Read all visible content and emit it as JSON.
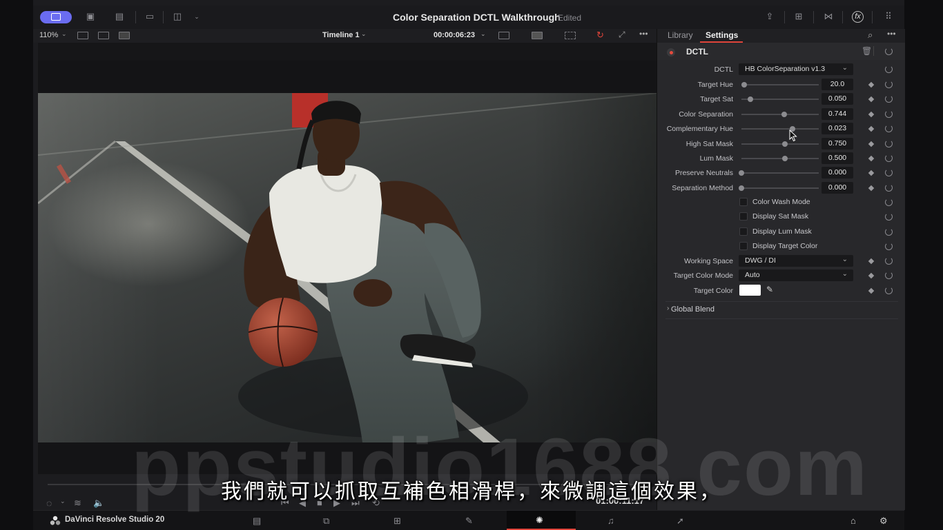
{
  "window": {
    "title": "Color Separation DCTL Walkthrough",
    "status": "Edited"
  },
  "viewer": {
    "zoom": "110%",
    "timeline": "Timeline 1",
    "timecode": "00:00:06:23",
    "record_timecode": "01:00:11:17"
  },
  "inspector": {
    "tabs": [
      "Library",
      "Settings"
    ],
    "active_tab": "Settings",
    "effect_name": "DCTL",
    "dctl": {
      "label": "DCTL",
      "value": "HB ColorSeparation v1.3"
    },
    "sliders": [
      {
        "label": "Target Hue",
        "value": "20.0",
        "level": 0.04
      },
      {
        "label": "Target Sat",
        "value": "0.050",
        "level": 0.12
      },
      {
        "label": "Color Separation",
        "value": "0.744",
        "level": 0.55
      },
      {
        "label": "Complementary Hue",
        "value": "0.023",
        "level": 0.66
      },
      {
        "label": "High Sat Mask",
        "value": "0.750",
        "level": 0.56
      },
      {
        "label": "Lum Mask",
        "value": "0.500",
        "level": 0.56
      },
      {
        "label": "Preserve Neutrals",
        "value": "0.000",
        "level": 0.0
      },
      {
        "label": "Separation Method",
        "value": "0.000",
        "level": 0.0
      }
    ],
    "checkboxes": [
      {
        "label": "Color Wash Mode",
        "checked": false
      },
      {
        "label": "Display Sat Mask",
        "checked": false
      },
      {
        "label": "Display Lum Mask",
        "checked": false
      },
      {
        "label": "Display Target Color",
        "checked": false
      }
    ],
    "working_space": {
      "label": "Working Space",
      "value": "DWG / DI"
    },
    "target_color_mode": {
      "label": "Target Color Mode",
      "value": "Auto"
    },
    "target_color": {
      "label": "Target Color",
      "color": "#ffffff"
    },
    "global_blend": "Global Blend"
  },
  "footer": {
    "brand": "DaVinci Resolve Studio 20",
    "active_page": "color"
  },
  "overlay": {
    "watermark": "ppstudio1688.com",
    "subtitle": "我們就可以抓取互補色相滑桿，來微調這個效果，"
  },
  "colors": {
    "accent": "#e0443a",
    "active_button": "#6a6cf0"
  }
}
